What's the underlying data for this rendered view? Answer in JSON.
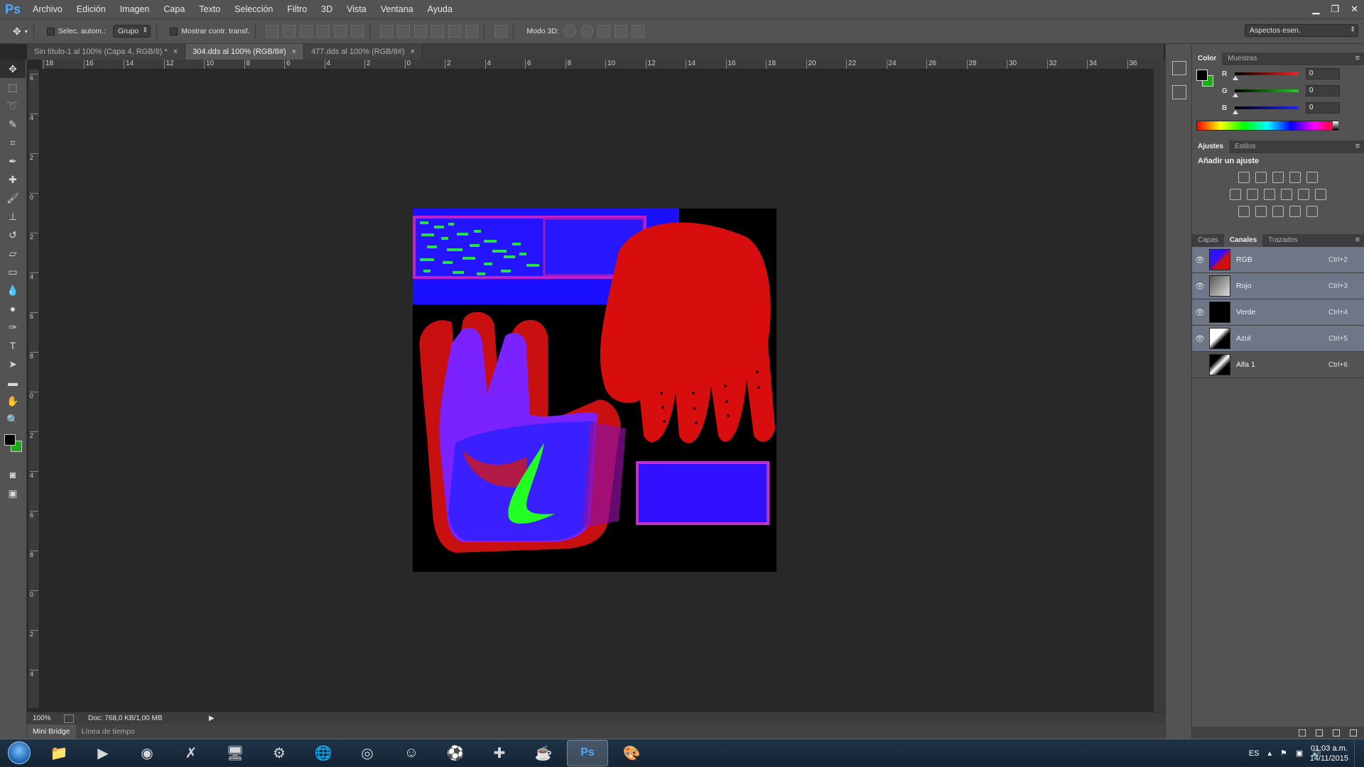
{
  "app": {
    "logo": "Ps"
  },
  "menu": [
    "Archivo",
    "Edición",
    "Imagen",
    "Capa",
    "Texto",
    "Selección",
    "Filtro",
    "3D",
    "Vista",
    "Ventana",
    "Ayuda"
  ],
  "window_controls": {
    "minimize": "▁",
    "restore": "❐",
    "close": "✕"
  },
  "options": {
    "autoselect_label": "Selec. autom.:",
    "autoselect_value": "Grupo",
    "transform_label": "Mostrar contr. transf.",
    "mode3d_label": "Modo 3D:",
    "workspace": "Aspectos esen."
  },
  "tabs": [
    {
      "label": "Sin título-1 al 100% (Capa 4, RGB/8) *",
      "active": false
    },
    {
      "label": "304.dds al 100% (RGB/8#)",
      "active": true
    },
    {
      "label": "477.dds al 100% (RGB/8#)",
      "active": false
    }
  ],
  "tab_close_glyph": "×",
  "ruler_h": [
    "18",
    "16",
    "14",
    "12",
    "10",
    "8",
    "6",
    "4",
    "2",
    "0",
    "2",
    "4",
    "6",
    "8",
    "10",
    "12",
    "14",
    "16",
    "18",
    "20",
    "22",
    "24",
    "26",
    "28",
    "30",
    "32",
    "34",
    "36"
  ],
  "ruler_v": [
    "6",
    "4",
    "2",
    "0",
    "2",
    "4",
    "6",
    "8",
    "0",
    "2",
    "4",
    "6",
    "8",
    "0",
    "2",
    "4"
  ],
  "status": {
    "zoom": "100%",
    "doc": "Doc: 768,0 KB/1,00 MB"
  },
  "bottom_tabs": [
    "Mini Bridge",
    "Línea de tiempo"
  ],
  "color_panel": {
    "tabs": [
      "Color",
      "Muestras"
    ],
    "channels": [
      {
        "label": "R",
        "value": "0",
        "color": "#ff2020"
      },
      {
        "label": "G",
        "value": "0",
        "color": "#20d020"
      },
      {
        "label": "B",
        "value": "0",
        "color": "#2020ff"
      }
    ],
    "foreground": "#000000",
    "background": "#1eaa1e"
  },
  "adjust_panel": {
    "tabs": [
      "Ajustes",
      "Estilos"
    ],
    "title": "Añadir un ajuste"
  },
  "channels_panel": {
    "tabs": [
      "Capas",
      "Canales",
      "Trazados"
    ],
    "rows": [
      {
        "name": "RGB",
        "shortcut": "Ctrl+2",
        "visible": true
      },
      {
        "name": "Rojo",
        "shortcut": "Ctrl+3",
        "visible": true
      },
      {
        "name": "Verde",
        "shortcut": "Ctrl+4",
        "visible": true
      },
      {
        "name": "Azul",
        "shortcut": "Ctrl+5",
        "visible": true
      },
      {
        "name": "Alfa 1",
        "shortcut": "Ctrl+6",
        "visible": false
      }
    ]
  },
  "taskbar": {
    "apps": [
      {
        "name": "file-explorer",
        "glyph": "📁",
        "active": false
      },
      {
        "name": "media-player",
        "glyph": "▶",
        "active": false
      },
      {
        "name": "chrome",
        "glyph": "◉",
        "active": false
      },
      {
        "name": "app-x",
        "glyph": "✗",
        "active": false
      },
      {
        "name": "computer",
        "glyph": "🖥",
        "active": false
      },
      {
        "name": "steam",
        "glyph": "⚙",
        "active": false
      },
      {
        "name": "globe",
        "glyph": "🌐",
        "active": false
      },
      {
        "name": "origin",
        "glyph": "◎",
        "active": false
      },
      {
        "name": "portrait",
        "glyph": "☺",
        "active": false
      },
      {
        "name": "game",
        "glyph": "⚽",
        "active": false
      },
      {
        "name": "ps-controller",
        "glyph": "✚",
        "active": false
      },
      {
        "name": "java",
        "glyph": "☕",
        "active": false
      },
      {
        "name": "photoshop",
        "glyph": "Ps",
        "active": true
      },
      {
        "name": "paint",
        "glyph": "🎨",
        "active": false
      }
    ],
    "lang": "ES",
    "time": "01:03 a.m.",
    "date": "14/11/2015"
  }
}
